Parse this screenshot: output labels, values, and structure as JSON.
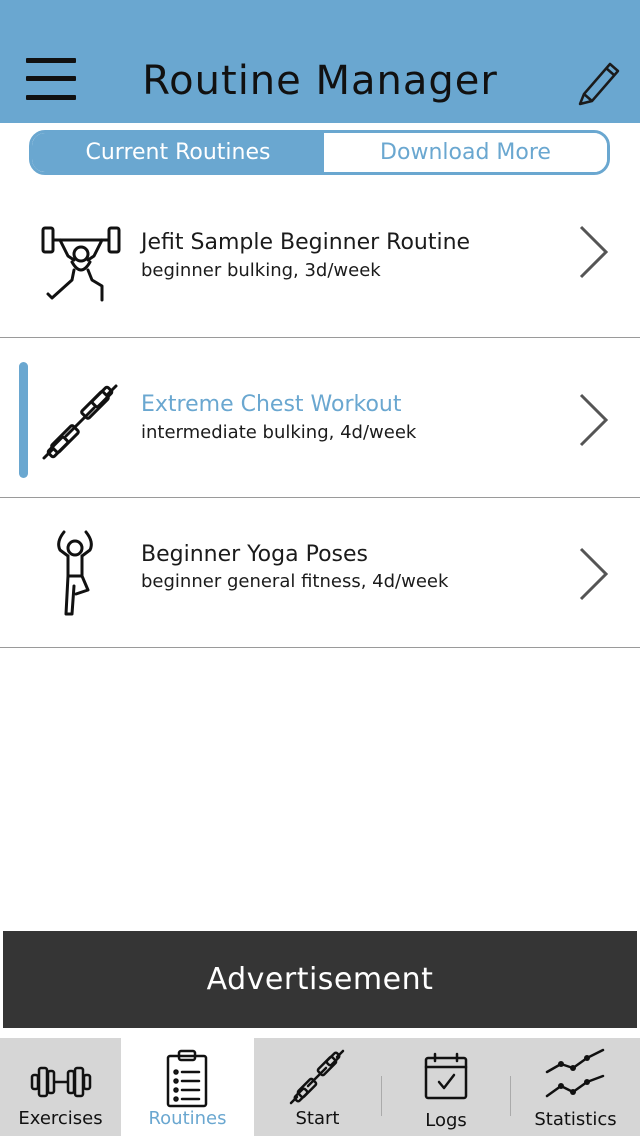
{
  "header": {
    "title": "Routine Manager",
    "menu_icon": "hamburger-menu-icon",
    "edit_icon": "pencil-icon",
    "background_color": "#6aa7d0"
  },
  "segment": {
    "tabs": [
      {
        "label": "Current Routines",
        "active": true
      },
      {
        "label": "Download More",
        "active": false
      }
    ]
  },
  "routines": [
    {
      "name": "Jefit Sample Beginner Routine",
      "description": "beginner bulking, 3d/week",
      "icon": "weightlifter-icon",
      "selected": false
    },
    {
      "name": "Extreme Chest Workout",
      "description": "intermediate bulking, 4d/week",
      "icon": "barbell-icon",
      "selected": true
    },
    {
      "name": "Beginner Yoga Poses",
      "description": "beginner general fitness, 4d/week",
      "icon": "yoga-pose-icon",
      "selected": false
    }
  ],
  "ad": {
    "label": "Advertisement"
  },
  "tabbar": {
    "items": [
      {
        "label": "Exercises",
        "icon": "dumbbell-icon",
        "active": false
      },
      {
        "label": "Routines",
        "icon": "clipboard-list-icon",
        "active": true
      },
      {
        "label": "Start",
        "icon": "barbell-icon",
        "active": false
      },
      {
        "label": "Logs",
        "icon": "calendar-check-icon",
        "active": false
      },
      {
        "label": "Statistics",
        "icon": "line-chart-icon",
        "active": false
      }
    ]
  },
  "colors": {
    "accent": "#6aa7d0",
    "ad_background": "#353535",
    "tabbar_background": "#d6d6d6"
  }
}
